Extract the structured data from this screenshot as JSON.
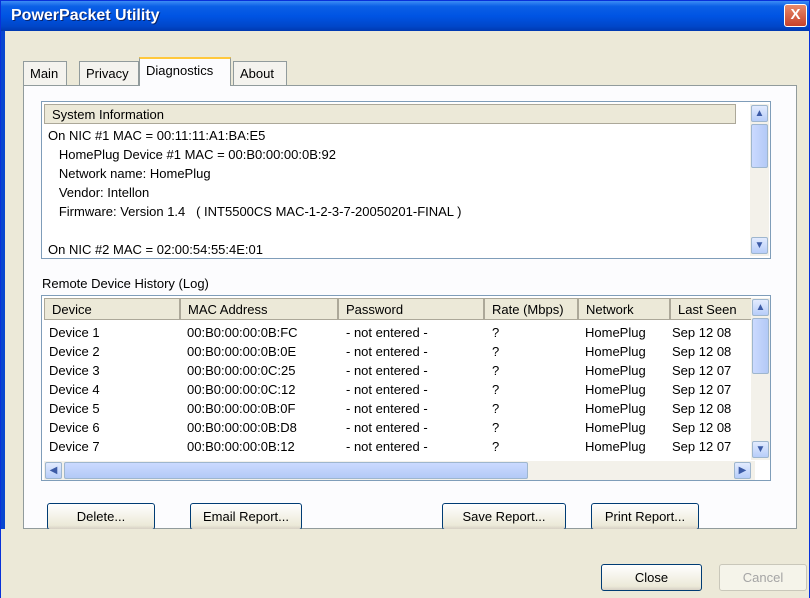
{
  "window": {
    "title": "PowerPacket Utility",
    "close_glyph": "X"
  },
  "tabs": [
    {
      "label": "Main"
    },
    {
      "label": "Privacy"
    },
    {
      "label": "Diagnostics"
    },
    {
      "label": "About"
    }
  ],
  "system_info": {
    "header": "System Information",
    "lines": [
      "On NIC #1 MAC = 00:11:11:A1:BA:E5",
      "   HomePlug Device #1 MAC = 00:B0:00:00:0B:92",
      "   Network name: HomePlug",
      "   Vendor: Intellon",
      "   Firmware: Version 1.4   ( INT5500CS MAC-1-2-3-7-20050201-FINAL )",
      "",
      "On NIC #2 MAC = 02:00:54:55:4E:01"
    ]
  },
  "log": {
    "label": "Remote Device History (Log)",
    "columns": [
      "Device",
      "MAC Address",
      "Password",
      "Rate (Mbps)",
      "Network",
      "Last Seen"
    ],
    "rows": [
      [
        "Device 1",
        "00:B0:00:00:0B:FC",
        "- not entered -",
        "?",
        "HomePlug",
        "Sep 12 08"
      ],
      [
        "Device 2",
        "00:B0:00:00:0B:0E",
        "- not entered -",
        "?",
        "HomePlug",
        "Sep 12 08"
      ],
      [
        "Device 3",
        "00:B0:00:00:0C:25",
        "- not entered -",
        "?",
        "HomePlug",
        "Sep 12 07"
      ],
      [
        "Device 4",
        "00:B0:00:00:0C:12",
        "- not entered -",
        "?",
        "HomePlug",
        "Sep 12 07"
      ],
      [
        "Device 5",
        "00:B0:00:00:0B:0F",
        "- not entered -",
        "?",
        "HomePlug",
        "Sep 12 08"
      ],
      [
        "Device 6",
        "00:B0:00:00:0B:D8",
        "- not entered -",
        "?",
        "HomePlug",
        "Sep 12 08"
      ],
      [
        "Device 7",
        "00:B0:00:00:0B:12",
        "- not entered -",
        "?",
        "HomePlug",
        "Sep 12 07"
      ]
    ]
  },
  "buttons": {
    "delete": "Delete...",
    "email": "Email Report...",
    "save": "Save Report...",
    "print": "Print Report...",
    "close": "Close",
    "cancel": "Cancel"
  },
  "icons": {
    "scroll_up": "up-arrow-icon",
    "scroll_down": "down-arrow-icon",
    "scroll_left": "left-arrow-icon",
    "scroll_right": "right-arrow-icon"
  },
  "colors": {
    "titlebar": "#0054e3",
    "tab_active_accent": "#ffc83c",
    "window_bg": "#ece9d8"
  }
}
